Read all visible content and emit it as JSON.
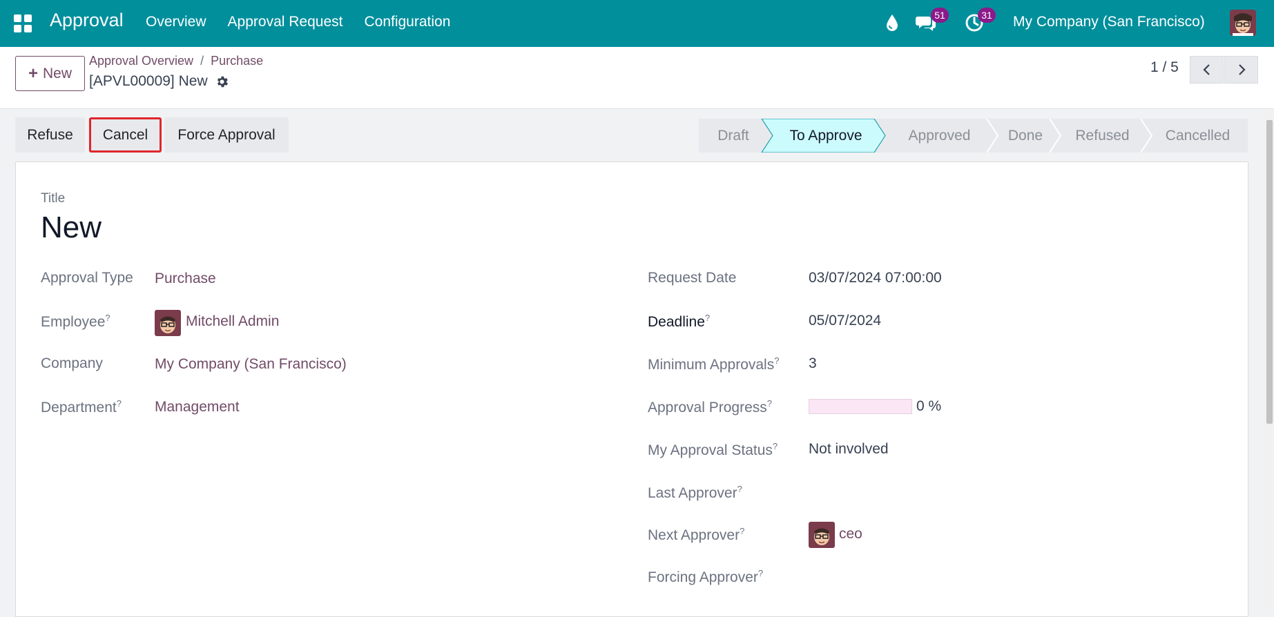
{
  "navbar": {
    "brand": "Approval",
    "menu": [
      "Overview",
      "Approval Request",
      "Configuration"
    ],
    "messages_badge": "51",
    "activities_badge": "31",
    "company": "My Company (San Francisco)"
  },
  "control_panel": {
    "new_label": "New",
    "breadcrumb": [
      "Approval Overview",
      "Purchase"
    ],
    "separator": "/",
    "record_title": "[APVL00009] New",
    "pager": "1 / 5"
  },
  "actions": {
    "refuse": "Refuse",
    "cancel": "Cancel",
    "force_approval": "Force Approval"
  },
  "stages": [
    "Draft",
    "To Approve",
    "Approved",
    "Done",
    "Refused",
    "Cancelled"
  ],
  "active_stage": "To Approve",
  "form": {
    "title_label": "Title",
    "title_value": "New",
    "left": {
      "approval_type": {
        "label": "Approval Type",
        "value": "Purchase"
      },
      "employee": {
        "label": "Employee",
        "value": "Mitchell Admin"
      },
      "company": {
        "label": "Company",
        "value": "My Company (San Francisco)"
      },
      "department": {
        "label": "Department",
        "value": "Management"
      }
    },
    "right": {
      "request_date": {
        "label": "Request Date",
        "value": "03/07/2024 07:00:00"
      },
      "deadline": {
        "label": "Deadline",
        "value": "05/07/2024"
      },
      "minimum_approvals": {
        "label": "Minimum Approvals",
        "value": "3"
      },
      "approval_progress": {
        "label": "Approval Progress",
        "value": "0 %",
        "percent": 0
      },
      "my_approval_status": {
        "label": "My Approval Status",
        "value": "Not involved"
      },
      "last_approver": {
        "label": "Last Approver",
        "value": ""
      },
      "next_approver": {
        "label": "Next Approver",
        "value": "ceo"
      },
      "forcing_approver": {
        "label": "Forcing Approver",
        "value": ""
      }
    },
    "help_marker": "?"
  },
  "colors": {
    "navbar": "#018f9c",
    "accent": "#714b67",
    "active_stage": "#ccfbfd",
    "badge": "#8b1a8a",
    "highlight": "#e0262b"
  }
}
